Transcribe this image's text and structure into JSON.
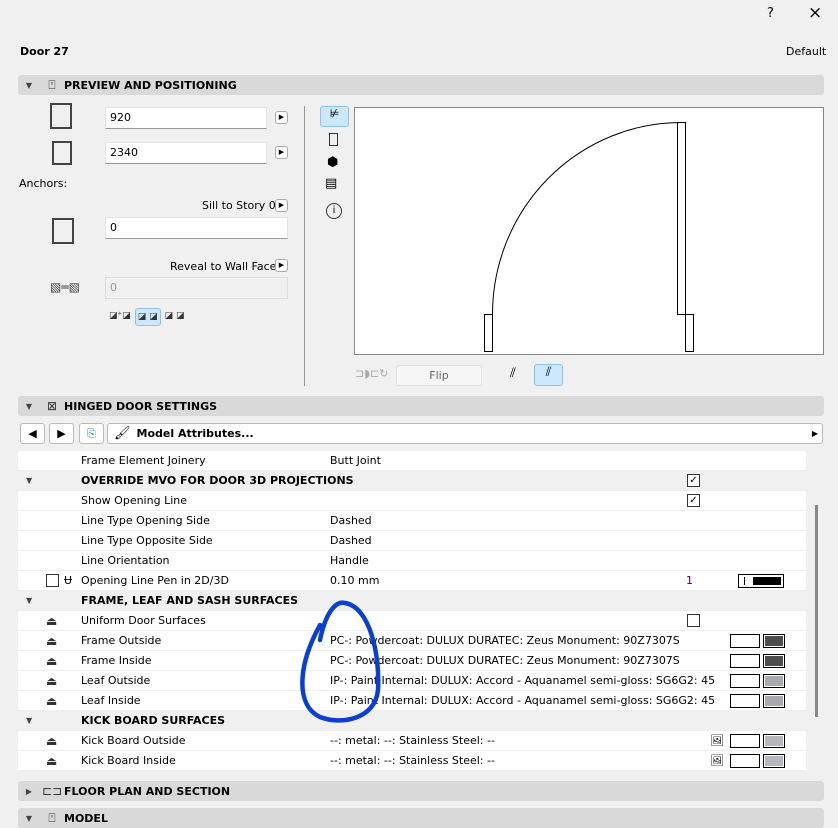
{
  "window": {
    "help": "?",
    "close": "×",
    "title": "Door 27",
    "preset": "Default"
  },
  "preview": {
    "header": "PREVIEW AND POSITIONING",
    "width": "920",
    "height": "2340",
    "anchors_label": "Anchors:",
    "sill_label": "Sill to Story 0",
    "sill_value": "0",
    "reveal_label": "Reveal to Wall Face",
    "reveal_value": "0",
    "flip_label": "Flip"
  },
  "settings": {
    "header": "HINGED DOOR SETTINGS",
    "model_attributes": "Model Attributes...",
    "rows": [
      {
        "type": "row",
        "name": "Frame Element Joinery",
        "value": "Butt Joint"
      },
      {
        "type": "header",
        "name": "OVERRIDE MVO FOR DOOR 3D PROJECTIONS",
        "check": true
      },
      {
        "type": "row",
        "name": "Show Opening Line",
        "check": true
      },
      {
        "type": "row",
        "name": "Line Type Opening Side",
        "value": "Dashed"
      },
      {
        "type": "row",
        "name": "Line Type Opposite Side",
        "value": "Dashed"
      },
      {
        "type": "row",
        "name": "Line Orientation",
        "value": "Handle"
      },
      {
        "type": "row",
        "name": "Opening Line Pen in 2D/3D",
        "value": "0.10 mm",
        "pen": "1",
        "icon": "pen-icon"
      },
      {
        "type": "header",
        "name": "FRAME, LEAF AND SASH SURFACES"
      },
      {
        "type": "row",
        "name": "Uniform Door Surfaces",
        "check": false,
        "icon": "brush-icon"
      },
      {
        "type": "row",
        "name": "Frame Outside",
        "value": "PC-: Powdercoat: DULUX DURATEC: Zeus Monument: 90Z7307S",
        "color": "#4d4d4d",
        "icon": "brush-icon"
      },
      {
        "type": "row",
        "name": "Frame Inside",
        "value": "PC-: Powdercoat: DULUX DURATEC: Zeus Monument: 90Z7307S",
        "color": "#4d4d4d",
        "icon": "brush-icon"
      },
      {
        "type": "row",
        "name": "Leaf Outside",
        "value": "IP-: Paint Internal: DULUX: Accord - Aquanamel semi-gloss: SG6G2: 45",
        "color": "#a7a9ac",
        "icon": "brush-icon"
      },
      {
        "type": "row",
        "name": "Leaf Inside",
        "value": "IP-: Paint Internal: DULUX: Accord - Aquanamel semi-gloss: SG6G2: 45",
        "color": "#a7a9ac",
        "icon": "brush-icon"
      },
      {
        "type": "header",
        "name": "KICK BOARD SURFACES"
      },
      {
        "type": "row",
        "name": "Kick Board Outside",
        "value": "--: metal: --: Stainless Steel: --",
        "color": "#b6b6c0",
        "texture": true,
        "icon": "brush-icon"
      },
      {
        "type": "row",
        "name": "Kick Board Inside",
        "value": "--: metal: --: Stainless Steel: --",
        "color": "#b6b6c0",
        "texture": true,
        "icon": "brush-icon"
      }
    ]
  },
  "floor_plan": {
    "header": "FLOOR PLAN AND SECTION"
  },
  "model": {
    "header": "MODEL"
  },
  "colors": {
    "annotation": "#0a3fd6",
    "selected": "#cce8ff"
  }
}
